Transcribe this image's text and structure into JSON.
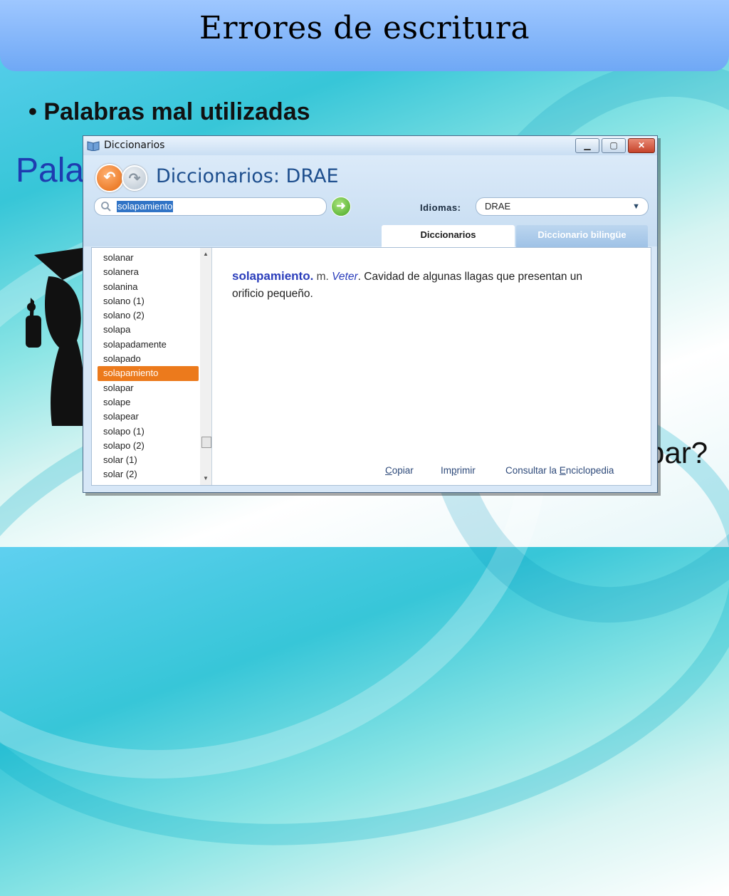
{
  "slide": {
    "title": "Errores de escritura",
    "bullet": "• Palabras mal utilizadas",
    "bg_partial_left": "Pala",
    "bg_partial_right": "par?"
  },
  "window": {
    "title": "Diccionarios",
    "controls": {
      "minimize": "▁",
      "maximize": "▢",
      "close": "✕"
    },
    "heading": "Diccionarios: DRAE",
    "search": {
      "value": "solapamiento"
    },
    "idiomas": {
      "label": "Idiomas:",
      "selected": "DRAE"
    },
    "tabs": [
      {
        "label": "Diccionarios",
        "active": true
      },
      {
        "label": "Diccionario bilingüe",
        "active": false
      }
    ],
    "word_list": [
      "solanar",
      "solanera",
      "solanina",
      "solano (1)",
      "solano (2)",
      "solapa",
      "solapadamente",
      "solapado",
      "solapamiento",
      "solapar",
      "solape",
      "solapear",
      "solapo (1)",
      "solapo (2)",
      "solar (1)",
      "solar (2)"
    ],
    "selected_word": "solapamiento",
    "definition": {
      "headword": "solapamiento.",
      "gram": "m.",
      "abbr": "Veter",
      "text": ". Cavidad de algunas llagas que presentan un orificio pequeño."
    },
    "footer": {
      "copy_first": "C",
      "copy_rest": "opiar",
      "print_pre": "Im",
      "print_u": "p",
      "print_rest": "rimir",
      "encyc_pre": "Consultar la ",
      "encyc_u": "E",
      "encyc_rest": "nciclopedia"
    }
  },
  "colors": {
    "accent_orange": "#ec7a1c",
    "heading_blue": "#1e4f8e",
    "headword_blue": "#2a3dbb",
    "title_bar": "#7fb3f7"
  }
}
